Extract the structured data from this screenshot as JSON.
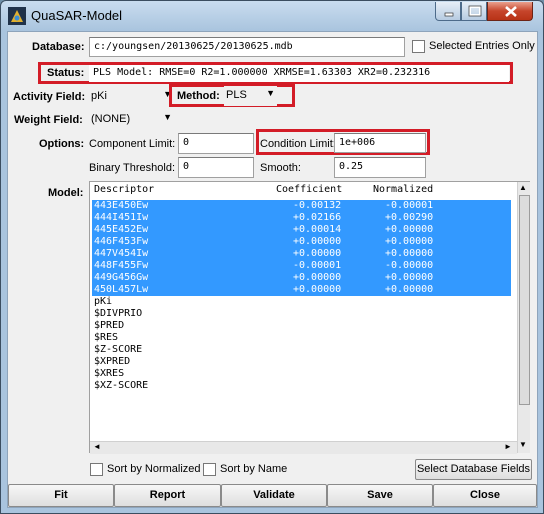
{
  "window": {
    "title": "QuaSAR-Model"
  },
  "database": {
    "label": "Database:",
    "value": "c:/youngsen/20130625/20130625.mdb",
    "selected_only_label": "Selected Entries Only"
  },
  "status": {
    "label": "Status:",
    "value": "PLS Model: RMSE=0 R2=1.000000 XRMSE=1.63303 XR2=0.232316"
  },
  "activity": {
    "label": "Activity Field:",
    "value": "pKi"
  },
  "method": {
    "label": "Method:",
    "value": "PLS"
  },
  "weight": {
    "label": "Weight Field:",
    "value": "(NONE)"
  },
  "options": {
    "label": "Options:",
    "component_limit_label": "Component Limit:",
    "component_limit_value": "0",
    "condition_limit_label": "Condition Limit:",
    "condition_limit_value": "1e+006",
    "binary_threshold_label": "Binary Threshold:",
    "binary_threshold_value": "0",
    "smooth_label": "Smooth:",
    "smooth_value": "0.25"
  },
  "model": {
    "label": "Model:",
    "headers": {
      "descriptor": "Descriptor",
      "coefficient": "Coefficient",
      "normalized": "Normalized"
    },
    "rows": [
      {
        "descriptor": "443E450Ew",
        "coefficient": "-0.00132",
        "normalized": "-0.00001",
        "selected": true
      },
      {
        "descriptor": "444I451Iw",
        "coefficient": "+0.02166",
        "normalized": "+0.00290",
        "selected": true
      },
      {
        "descriptor": "445E452Ew",
        "coefficient": "+0.00014",
        "normalized": "+0.00000",
        "selected": true
      },
      {
        "descriptor": "446F453Fw",
        "coefficient": "+0.00000",
        "normalized": "+0.00000",
        "selected": true
      },
      {
        "descriptor": "447V454Iw",
        "coefficient": "+0.00000",
        "normalized": "+0.00000",
        "selected": true
      },
      {
        "descriptor": "448F455Fw",
        "coefficient": "-0.00001",
        "normalized": "-0.00000",
        "selected": true
      },
      {
        "descriptor": "449G456Gw",
        "coefficient": "+0.00000",
        "normalized": "+0.00000",
        "selected": true
      },
      {
        "descriptor": "450L457Lw",
        "coefficient": "+0.00000",
        "normalized": "+0.00000",
        "selected": true
      },
      {
        "descriptor": "pKi",
        "coefficient": "",
        "normalized": "",
        "selected": false
      },
      {
        "descriptor": "$DIVPRIO",
        "coefficient": "",
        "normalized": "",
        "selected": false
      },
      {
        "descriptor": "$PRED",
        "coefficient": "",
        "normalized": "",
        "selected": false
      },
      {
        "descriptor": "$RES",
        "coefficient": "",
        "normalized": "",
        "selected": false
      },
      {
        "descriptor": "$Z-SCORE",
        "coefficient": "",
        "normalized": "",
        "selected": false
      },
      {
        "descriptor": "$XPRED",
        "coefficient": "",
        "normalized": "",
        "selected": false
      },
      {
        "descriptor": "$XRES",
        "coefficient": "",
        "normalized": "",
        "selected": false
      },
      {
        "descriptor": "$XZ-SCORE",
        "coefficient": "",
        "normalized": "",
        "selected": false
      }
    ]
  },
  "sort": {
    "by_normalized_label": "Sort by Normalized",
    "by_name_label": "Sort by Name"
  },
  "select_fields_button": "Select Database Fields",
  "buttons": {
    "fit": "Fit",
    "report": "Report",
    "validate": "Validate",
    "save": "Save",
    "close": "Close"
  },
  "colors": {
    "selection": "#3399ff",
    "highlight_box": "#d31c27",
    "close_button": "#c6452b"
  },
  "icons": {
    "dropdown": "▼",
    "scroll_up": "▲",
    "scroll_down": "▼",
    "scroll_left": "◄",
    "scroll_right": "►"
  }
}
